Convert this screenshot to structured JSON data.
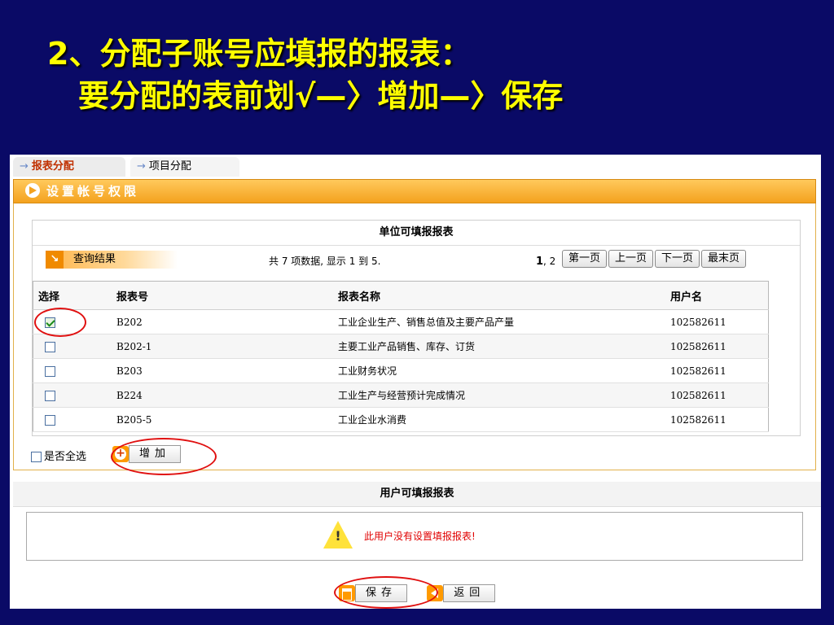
{
  "slide": {
    "title_line1": "2、分配子账号应填报的报表：",
    "title_line2": "要分配的表前划√—〉增加—〉保存"
  },
  "tabs": [
    {
      "label": "报表分配",
      "active": true
    },
    {
      "label": "项目分配",
      "active": false
    }
  ],
  "section": {
    "title": "设置帐号权限"
  },
  "unit_table": {
    "title": "单位可填报报表",
    "query_label": "查询结果",
    "count_text": "共 7 项数据, 显示 1 到 5.",
    "page_current": "1",
    "page_sep": ", 2",
    "pager": {
      "first": "第一页",
      "prev": "上一页",
      "next": "下一页",
      "last": "最末页"
    },
    "columns": [
      "选择",
      "报表号",
      "报表名称",
      "用户名"
    ],
    "rows": [
      {
        "checked": true,
        "code": "B202",
        "name": "工业企业生产、销售总值及主要产品产量",
        "user": "102582611"
      },
      {
        "checked": false,
        "code": "B202-1",
        "name": "主要工业产品销售、库存、订货",
        "user": "102582611"
      },
      {
        "checked": false,
        "code": "B203",
        "name": "工业财务状况",
        "user": "102582611"
      },
      {
        "checked": false,
        "code": "B224",
        "name": "工业生产与经营预计完成情况",
        "user": "102582611"
      },
      {
        "checked": false,
        "code": "B205-5",
        "name": "工业企业水消费",
        "user": "102582611"
      }
    ]
  },
  "controls": {
    "select_all": "是否全选",
    "add": "增加"
  },
  "user_table": {
    "title": "用户可填报报表",
    "message": "此用户没有设置填报报表!"
  },
  "bottom": {
    "save": "保存",
    "back": "返回"
  },
  "colors": {
    "accent": "#f4a21e",
    "annotation": "#e01010",
    "slide_bg": "#0a0a66",
    "title": "#ffff00"
  }
}
